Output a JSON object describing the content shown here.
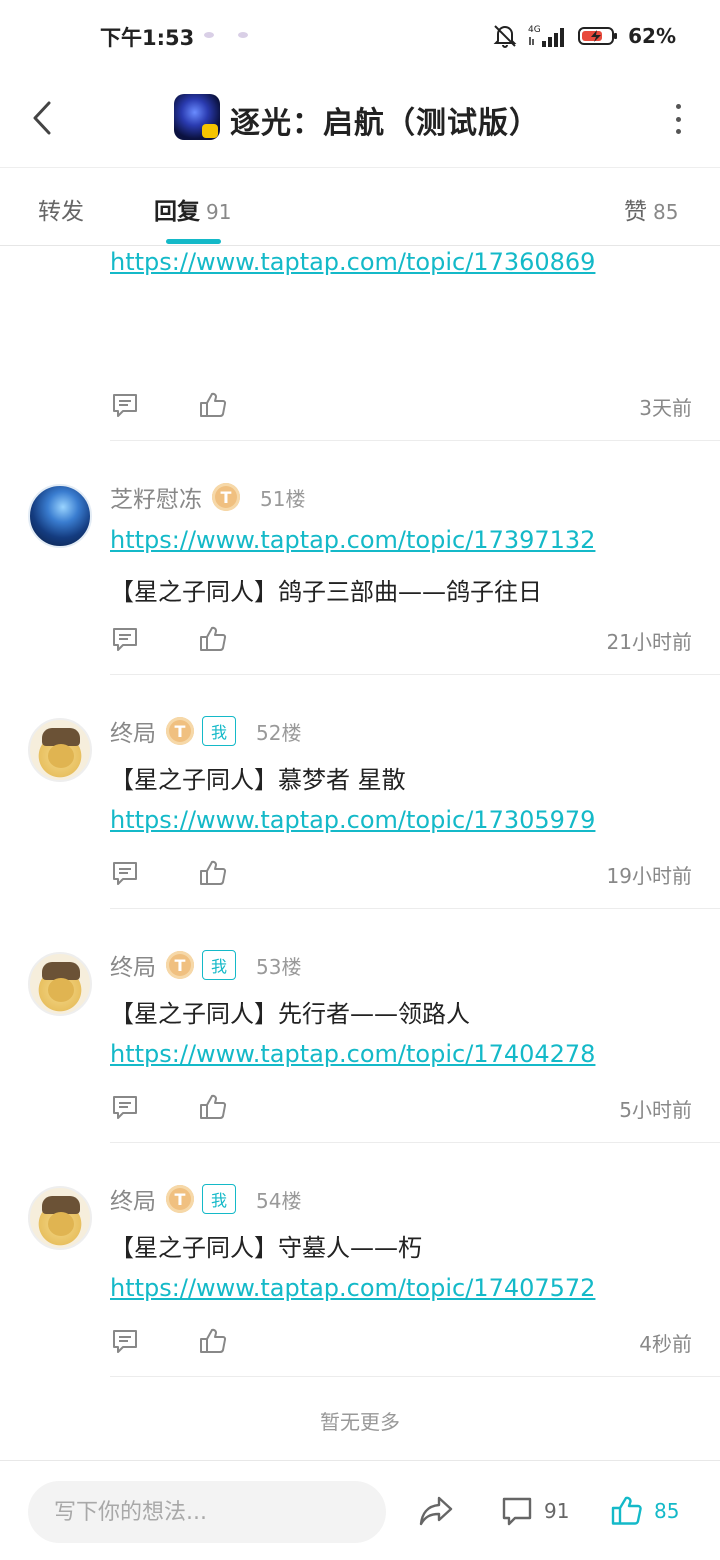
{
  "status_bar": {
    "time": "下午1:53",
    "network": "4G",
    "battery": "62%"
  },
  "header": {
    "title": "逐光：启航（测试版）"
  },
  "tabs": [
    {
      "label": "转发",
      "count": ""
    },
    {
      "label": "回复",
      "count": "91"
    },
    {
      "label": "赞",
      "count": "85"
    }
  ],
  "posts": [
    {
      "link": "https://www.taptap.com/topic/17360869",
      "time": "3天前"
    },
    {
      "user": "芝籽慰冻",
      "badge": "T",
      "floor": "51楼",
      "link": "https://www.taptap.com/topic/17397132",
      "text": "【星之子同人】鸽子三部曲——鸽子往日",
      "time": "21小时前"
    },
    {
      "user": "终局",
      "badge": "T",
      "me_tag": "我",
      "floor": "52楼",
      "text": "【星之子同人】慕梦者  星散",
      "link": "https://www.taptap.com/topic/17305979",
      "time": "19小时前"
    },
    {
      "user": "终局",
      "badge": "T",
      "me_tag": "我",
      "floor": "53楼",
      "text": "【星之子同人】先行者——领路人",
      "link": "https://www.taptap.com/topic/17404278",
      "time": "5小时前"
    },
    {
      "user": "终局",
      "badge": "T",
      "me_tag": "我",
      "floor": "54楼",
      "text": "【星之子同人】守墓人——朽",
      "link": "https://www.taptap.com/topic/17407572",
      "time": "4秒前"
    }
  ],
  "no_more": "暂无更多",
  "bottom_bar": {
    "input_placeholder": "写下你的想法...",
    "comment_count": "91",
    "like_count": "85"
  },
  "colors": {
    "accent": "#14b9c8",
    "text_primary": "#222222",
    "text_secondary": "#888888"
  }
}
